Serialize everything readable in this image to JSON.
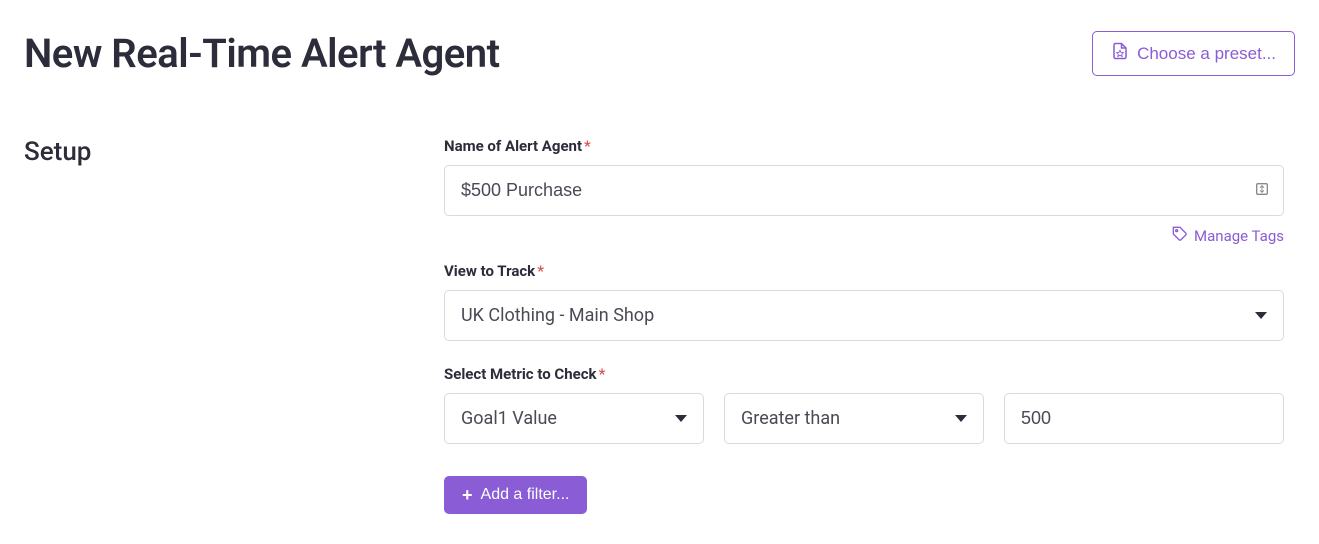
{
  "header": {
    "title": "New Real-Time Alert Agent",
    "preset_button": "Choose a preset..."
  },
  "section": {
    "label": "Setup"
  },
  "fields": {
    "name": {
      "label": "Name of Alert Agent",
      "required": "*",
      "value": "$500 Purchase"
    },
    "manage_tags": "Manage Tags",
    "view": {
      "label": "View to Track",
      "required": "*",
      "value": "UK Clothing - Main Shop"
    },
    "metric": {
      "label": "Select Metric to Check",
      "required": "*",
      "metric_value": "Goal1 Value",
      "comparator_value": "Greater than",
      "threshold_value": "500"
    },
    "add_filter": "Add a filter..."
  }
}
